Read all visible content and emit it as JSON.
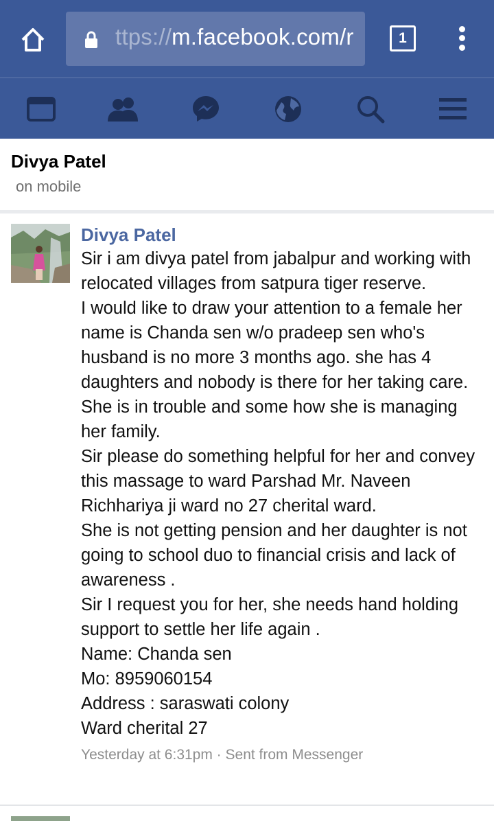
{
  "browser": {
    "url_dim": "ttps://",
    "url_main": "m.facebook.com/r",
    "tab_count": "1",
    "icons": [
      "home-icon",
      "lock-icon",
      "tabs-icon",
      "overflow-menu-icon"
    ]
  },
  "nav": {
    "icons": [
      "news-feed-icon",
      "friends-icon",
      "messenger-icon",
      "notifications-globe-icon",
      "search-icon",
      "menu-icon"
    ]
  },
  "conversation": {
    "name": "Divya Patel",
    "status": "on mobile"
  },
  "message": {
    "sender": "Divya Patel",
    "body": "Sir i am divya patel from jabalpur and working with relocated villages from satpura tiger reserve.\nI would like to draw your attention to a female her name is Chanda sen w/o pradeep sen who's husband is no more 3 months ago. she has 4 daughters and nobody is there for her taking care. She is in trouble and some how she is managing her family.\nSir please do something helpful for her and convey this massage to ward Parshad Mr. Naveen Richhariya ji ward no 27 cherital ward.\nShe is not getting pension and her daughter is not going to school duo to financial crisis and lack of awareness .\nSir I request you for her, she needs hand holding support to settle her life again .\nName: Chanda sen\nMo: 8959060154\nAddress : saraswati colony\nWard cherital 27",
    "meta": "Yesterday at 6:31pm · Sent from Messenger"
  },
  "colors": {
    "brand": "#3b5998",
    "url_box": "#6278ab",
    "sender_link": "#4b67a1",
    "meta_text": "#8d8d8d"
  }
}
